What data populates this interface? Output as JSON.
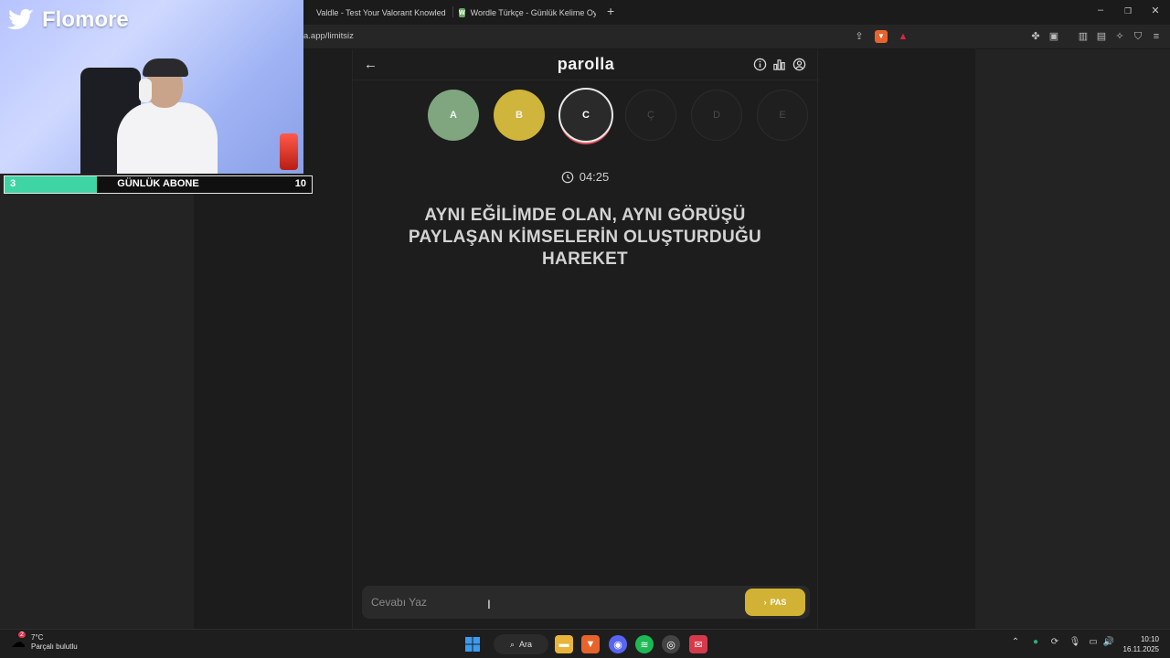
{
  "browser": {
    "tabs": [
      {
        "label": "Valdle - Test Your Valorant Knowledg",
        "favicon_color": "#e0354a"
      },
      {
        "label": "Wordle Türkçe - Günlük Kelime Oyun",
        "favicon_color": "#6aaa64",
        "favicon_letter": "W"
      }
    ],
    "url": "a.app/limitsiz",
    "new_tab_icon": "plus-icon",
    "window_controls": [
      "minimize-icon",
      "restore-icon",
      "close-icon"
    ]
  },
  "app": {
    "title": "parolla",
    "back_icon": "arrow-left-icon",
    "header_icons": [
      "info-icon",
      "stats-icon",
      "profile-icon"
    ],
    "letters": [
      {
        "letter": "A",
        "state": "correct"
      },
      {
        "letter": "B",
        "state": "passed"
      },
      {
        "letter": "C",
        "state": "current"
      },
      {
        "letter": "Ç",
        "state": "pending"
      },
      {
        "letter": "D",
        "state": "pending"
      },
      {
        "letter": "E",
        "state": "pending"
      }
    ],
    "timer": "04:25",
    "question": "AYNI EĞİLİMDE OLAN, AYNI GÖRÜŞÜ PAYLAŞAN KİMSELERİN OLUŞTURDUĞU HAREKET",
    "answer_placeholder": "Cevabı Yaz",
    "pass_label": "PAS",
    "colors": {
      "correct": "#7fa67f",
      "passed": "#cfb53b",
      "accent": "#d1b234"
    }
  },
  "overlay": {
    "brand": "Flomore",
    "brand_icon": "twitter-bird-icon",
    "sub_goal": {
      "label": "GÜNLÜK ABONE",
      "current": "3",
      "target": "10",
      "progress": 0.3
    }
  },
  "taskbar": {
    "weather_temp": "7°C",
    "weather_desc": "Parçalı bulutlu",
    "weather_badge": "2",
    "search_label": "Ara",
    "time": "10:10",
    "date": "16.11.2025"
  }
}
